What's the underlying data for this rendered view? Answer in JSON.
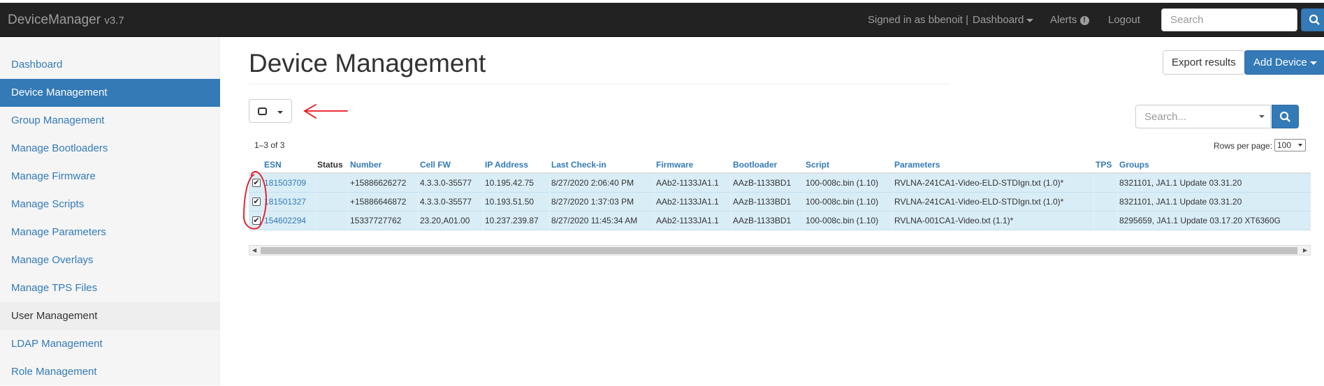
{
  "app": {
    "name": "DeviceManager",
    "version": "v3.7"
  },
  "nav": {
    "signed_in": "Signed in as bbenoit |",
    "dashboard": "Dashboard",
    "alerts": "Alerts",
    "alerts_icon": "!",
    "logout": "Logout",
    "search_placeholder": "Search"
  },
  "sidebar": {
    "items": [
      {
        "label": "Dashboard"
      },
      {
        "label": "Device Management"
      },
      {
        "label": "Group Management"
      },
      {
        "label": "Manage Bootloaders"
      },
      {
        "label": "Manage Firmware"
      },
      {
        "label": "Manage Scripts"
      },
      {
        "label": "Manage Parameters"
      },
      {
        "label": "Manage Overlays"
      },
      {
        "label": "Manage TPS Files"
      },
      {
        "label": "User Management"
      },
      {
        "label": "LDAP Management"
      },
      {
        "label": "Role Management"
      }
    ]
  },
  "main": {
    "title": "Device Management",
    "export_label": "Export results",
    "add_device_label": "Add Device",
    "table_search_placeholder": "Search...",
    "count": "1–3 of 3",
    "rows_per_page_label": "Rows per page:",
    "rows_per_page_value": "100"
  },
  "table": {
    "headers": [
      "ESN",
      "Status",
      "Number",
      "Cell FW",
      "IP Address",
      "Last Check-in",
      "Firmware",
      "Bootloader",
      "Script",
      "Parameters",
      "TPS",
      "Groups"
    ],
    "rows": [
      [
        "181503709",
        "",
        "+15886626272",
        "4.3.3.0-35577",
        "10.195.42.75",
        "8/27/2020 2:06:40 PM",
        "AAb2-1133JA1.1",
        "AAzB-1133BD1",
        "100-008c.bin (1.10)",
        "RVLNA-241CA1-Video-ELD-STDIgn.txt (1.0)*",
        "",
        "8321101, JA1.1 Update 03.31.20"
      ],
      [
        "181501327",
        "",
        "+15886646872",
        "4.3.3.0-35577",
        "10.193.51.50",
        "8/27/2020 1:37:03 PM",
        "AAb2-1133JA1.1",
        "AAzB-1133BD1",
        "100-008c.bin (1.10)",
        "RVLNA-241CA1-Video-ELD-STDIgn.txt (1.0)*",
        "",
        "8321101, JA1.1 Update 03.31.20"
      ],
      [
        "154602294",
        "",
        "15337727762",
        "23.20,A01.00",
        "10.237.239.87",
        "8/27/2020 11:45:34 AM",
        "AAb2-1133JA1.1",
        "AAzB-1133BD1",
        "100-008c.bin (1.10)",
        "RVLNA-001CA1-Video.txt (1.1)*",
        "",
        "8295659, JA1.1 Update 03.17.20 XT6360G"
      ]
    ],
    "checked": [
      true,
      true,
      true
    ]
  },
  "colors": {
    "primary": "#337ab7",
    "navbar": "#222222",
    "row_selected": "#d9edf7",
    "annotation": "#e8141c"
  }
}
